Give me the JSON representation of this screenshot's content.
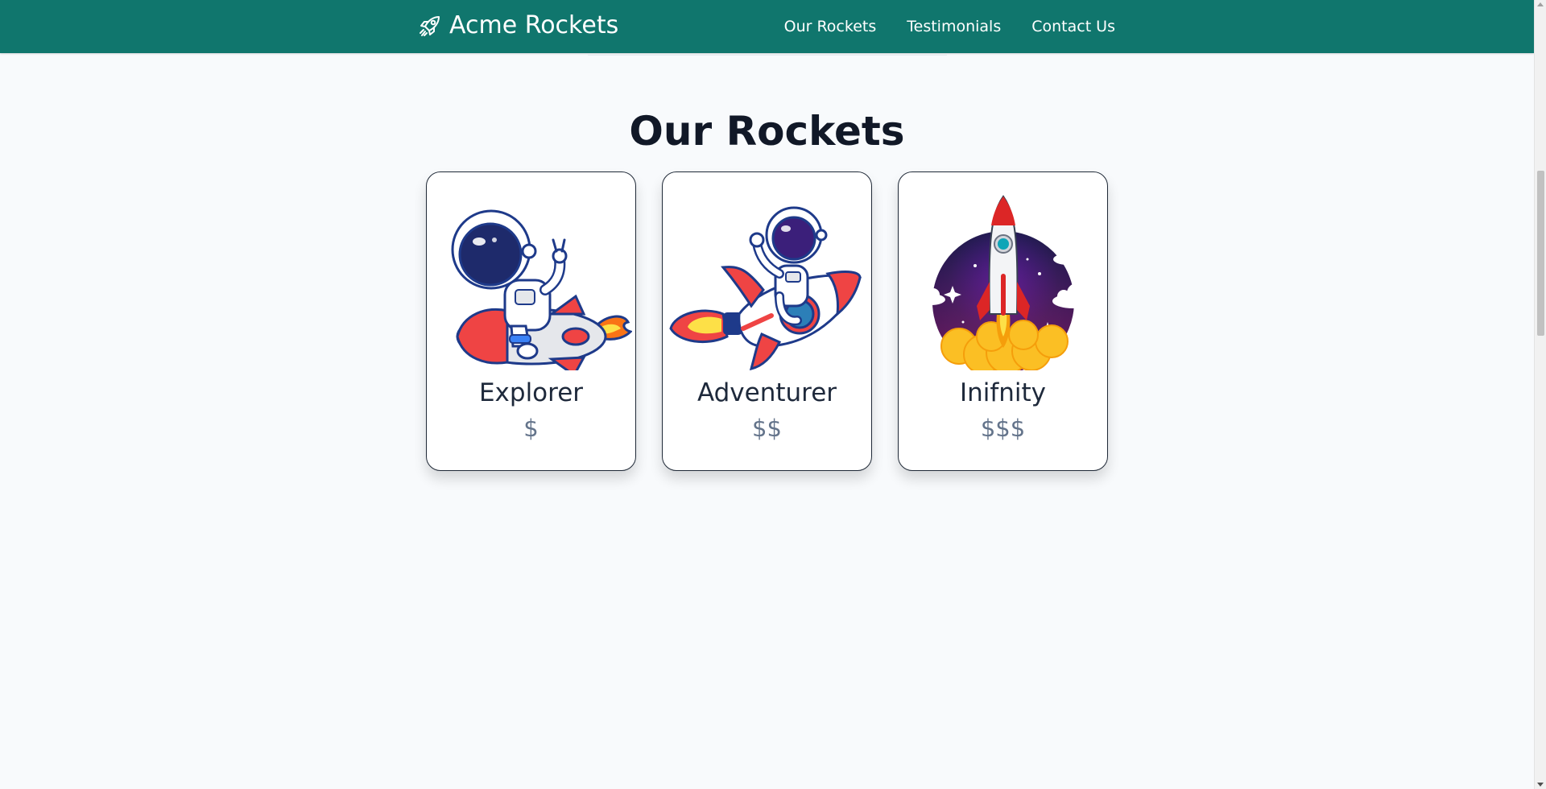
{
  "header": {
    "brand_name": "Acme Rockets",
    "brand_icon": "rocket-icon",
    "background_color": "#10766d",
    "nav": [
      {
        "label": "Our Rockets"
      },
      {
        "label": "Testimonials"
      },
      {
        "label": "Contact Us"
      }
    ]
  },
  "main": {
    "title": "Our Rockets",
    "cards": [
      {
        "name": "Explorer",
        "price": "$",
        "image": "astronaut-riding-rocket-peace-sign"
      },
      {
        "name": "Adventurer",
        "price": "$$",
        "image": "astronaut-waving-on-rocket"
      },
      {
        "name": "Inifnity",
        "price": "$$$",
        "image": "rocket-launch-night-sky"
      }
    ]
  }
}
